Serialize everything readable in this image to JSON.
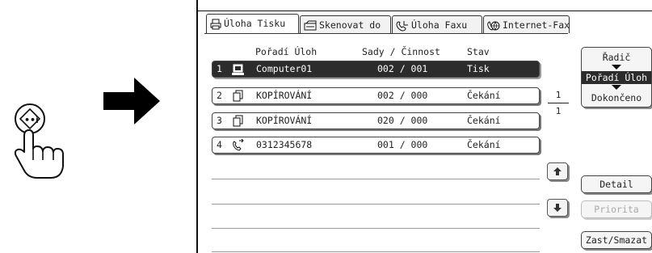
{
  "illustration": {
    "hand_icon": "hand-pressing-job-status-key-icon",
    "arrow_icon": "right-arrow-icon"
  },
  "tabs": [
    {
      "label": "Úloha Tisku",
      "icon": "printer-icon",
      "active": true
    },
    {
      "label": "Skenovat do",
      "icon": "scanner-icon",
      "active": false
    },
    {
      "label": "Úloha Faxu",
      "icon": "fax-phone-icon",
      "active": false
    },
    {
      "label": "Internet-Fax",
      "icon": "internet-fax-icon",
      "active": false
    }
  ],
  "columns": {
    "order": "Pořadí Úloh",
    "sets": "Sady / Činnost",
    "status": "Stav"
  },
  "jobs": [
    {
      "num": "1",
      "icon": "computer-job-icon",
      "name": "Computer01",
      "sets": "002 / 001",
      "status": "Tisk",
      "selected": true
    },
    {
      "num": "2",
      "icon": "copy-job-icon",
      "name": "KOPÍROVÁNÍ",
      "sets": "002 / 000",
      "status": "Čekání",
      "selected": false
    },
    {
      "num": "3",
      "icon": "copy-job-icon",
      "name": "KOPÍROVÁNÍ",
      "sets": "020 / 000",
      "status": "Čekání",
      "selected": false
    },
    {
      "num": "4",
      "icon": "fax-job-icon",
      "name": "0312345678",
      "sets": "001 / 000",
      "status": "Čekání",
      "selected": false
    }
  ],
  "pager": {
    "current": "1",
    "total": "1"
  },
  "sort": {
    "title": "Řadič",
    "selected": "Pořadí Úloh",
    "other": "Dokončeno"
  },
  "buttons": {
    "detail": "Detail",
    "priority": "Priorita",
    "stop_delete": "Zast/Smazat"
  },
  "colors": {
    "selected_bg": "#2c2c2c",
    "disabled_text": "#aaaaaa"
  }
}
